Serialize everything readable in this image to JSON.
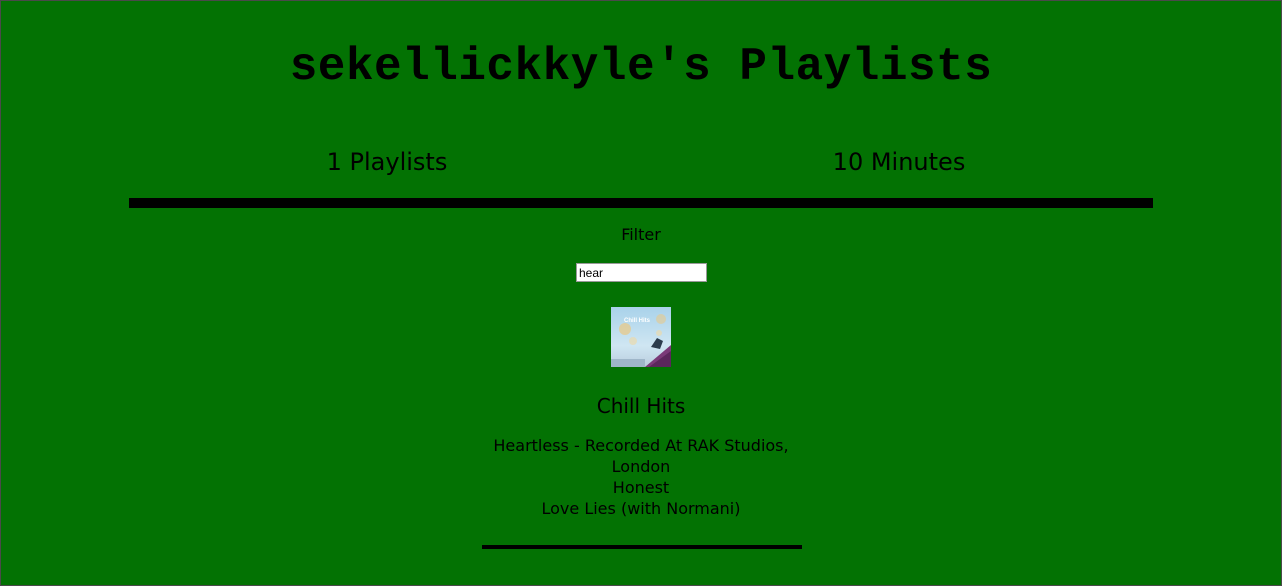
{
  "header": {
    "title": "sekellickkyle's Playlists"
  },
  "stats": {
    "playlists": "1 Playlists",
    "minutes": "10 Minutes"
  },
  "filter": {
    "label": "Filter",
    "value": "hear"
  },
  "playlists": [
    {
      "name": "Chill Hits",
      "cover_text": "Chill Hits",
      "tracks": [
        "Heartless - Recorded At RAK Studios, London",
        "Honest",
        "Love Lies (with Normani)"
      ]
    }
  ],
  "colors": {
    "background": "#037203",
    "text": "#000000",
    "divider": "#000000"
  }
}
